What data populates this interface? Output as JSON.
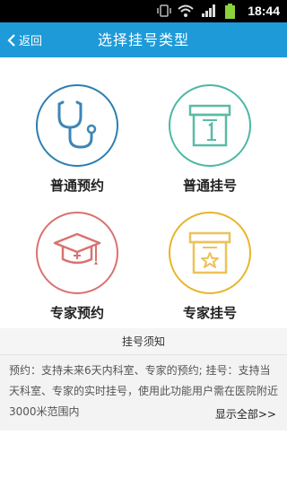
{
  "status_bar": {
    "time": "18:44"
  },
  "header": {
    "back_label": "返回",
    "title": "选择挂号类型"
  },
  "options": [
    {
      "label": "普通预约",
      "icon": "stethoscope-icon",
      "color": "#2a7fb0"
    },
    {
      "label": "普通挂号",
      "icon": "ticket-box-icon",
      "color": "#4bb7a3"
    },
    {
      "label": "专家预约",
      "icon": "graduation-cap-icon",
      "color": "#d8726f"
    },
    {
      "label": "专家挂号",
      "icon": "star-box-icon",
      "color": "#e7b52a"
    }
  ],
  "notice": {
    "title": "挂号须知",
    "body": "预约：支持未来6天内科室、专家的预约; 挂号：支持当天科室、专家的实时挂号，使用此功能用户需在医院附近3000米范围内",
    "show_all": "显示全部>>"
  },
  "colors": {
    "accent": "#1e9ad8"
  }
}
